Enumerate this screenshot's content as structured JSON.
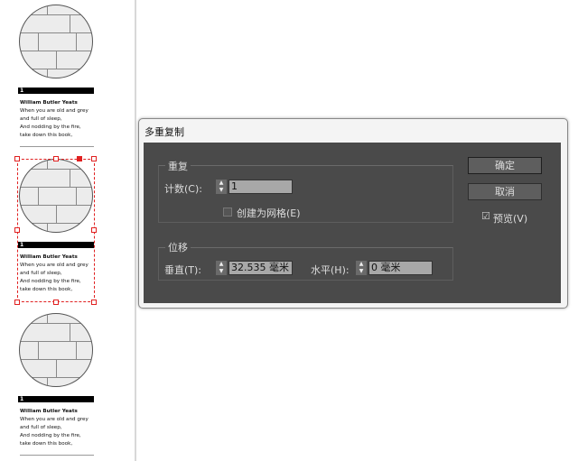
{
  "cards": [
    {
      "number": "1",
      "author": "William Butler Yeats",
      "lines": [
        "When you are old and grey",
        "and full of sleep,",
        "And nodding by the fire,",
        "take down this book,"
      ]
    },
    {
      "number": "1",
      "author": "William Butler Yeats",
      "lines": [
        "When you are old and grey",
        "and full of sleep,",
        "And nodding by the fire,",
        "take down this book,"
      ]
    },
    {
      "number": "1",
      "author": "William Butler Yeats",
      "lines": [
        "When you are old and grey",
        "and full of sleep,",
        "And nodding by the fire,",
        "take down this book,"
      ]
    }
  ],
  "dialog": {
    "title": "多重复制",
    "repeat_group": "重复",
    "count_label": "计数(C):",
    "count_value": "1",
    "grid_label": "创建为网格(E)",
    "grid_checked": false,
    "offset_group": "位移",
    "vertical_label": "垂直(T):",
    "vertical_value": "32.535 毫米",
    "horizontal_label": "水平(H):",
    "horizontal_value": "0 毫米",
    "ok": "确定",
    "cancel": "取消",
    "preview_label": "预览(V)",
    "preview_checked": true
  }
}
